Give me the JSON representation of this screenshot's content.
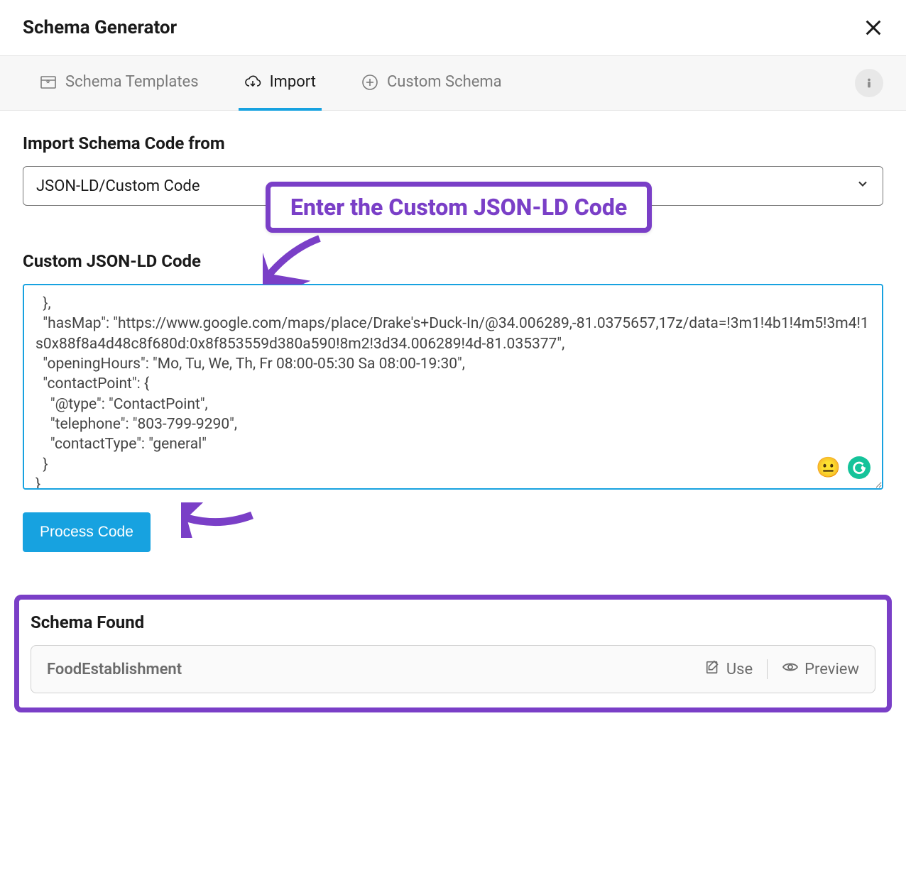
{
  "modal": {
    "title": "Schema Generator"
  },
  "tabs": {
    "templates": "Schema Templates",
    "import": "Import",
    "custom": "Custom Schema"
  },
  "import": {
    "source_label": "Import Schema Code from",
    "source_value": "JSON-LD/Custom Code",
    "code_label": "Custom JSON-LD Code",
    "code_value": "  },\n  \"hasMap\": \"https://www.google.com/maps/place/Drake's+Duck-In/@34.006289,-81.0375657,17z/data=!3m1!4b1!4m5!3m4!1s0x88f8a4d48c8f680d:0x8f853559d380a590!8m2!3d34.006289!4d-81.035377\",\n  \"openingHours\": \"Mo, Tu, We, Th, Fr 08:00-05:30 Sa 08:00-19:30\",\n  \"contactPoint\": {\n    \"@type\": \"ContactPoint\",\n    \"telephone\": \"803-799-9290\",\n    \"contactType\": \"general\"\n  }\n}",
    "process_button": "Process Code"
  },
  "annotation": {
    "callout": "Enter the Custom JSON-LD Code"
  },
  "schema_found": {
    "title": "Schema Found",
    "items": [
      {
        "name": "FoodEstablishment"
      }
    ],
    "use_label": "Use",
    "preview_label": "Preview"
  },
  "icons": {
    "emoji": "😐"
  }
}
